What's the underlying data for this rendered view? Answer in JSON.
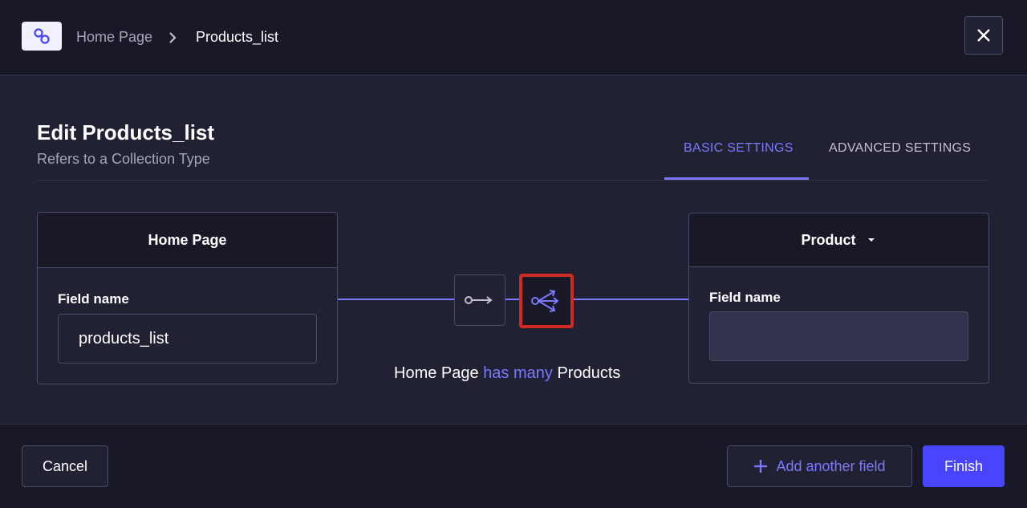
{
  "breadcrumb": {
    "logo_icon": "link-icon",
    "home": "Home Page",
    "separator_icon": "chevron-right-icon",
    "current": "Products_list"
  },
  "header": {
    "close_icon": "close-icon"
  },
  "modal": {
    "title": "Edit Products_list",
    "subtitle": "Refers to a Collection Type"
  },
  "tabs": [
    {
      "label": "BASIC SETTINGS",
      "active": true
    },
    {
      "label": "ADVANCED SETTINGS",
      "active": false
    }
  ],
  "left_card": {
    "title": "Home Page",
    "field_label": "Field name",
    "field_value": "products_list"
  },
  "right_card": {
    "title": "Product",
    "dropdown_icon": "caret-down-icon",
    "field_label": "Field name",
    "field_value": ""
  },
  "relation": {
    "one_way_icon": "one-way-relation-icon",
    "has_many_icon": "has-many-relation-icon",
    "text_start": "Home Page",
    "text_accent": "has many",
    "text_end": "Products"
  },
  "footer": {
    "cancel": "Cancel",
    "add_field": "Add another field",
    "add_icon": "plus-icon",
    "finish": "Finish"
  },
  "colors": {
    "accent": "#7b79ff",
    "primary": "#4945ff",
    "highlight": "#d02b20",
    "background": "#212134",
    "panel": "#181826"
  }
}
